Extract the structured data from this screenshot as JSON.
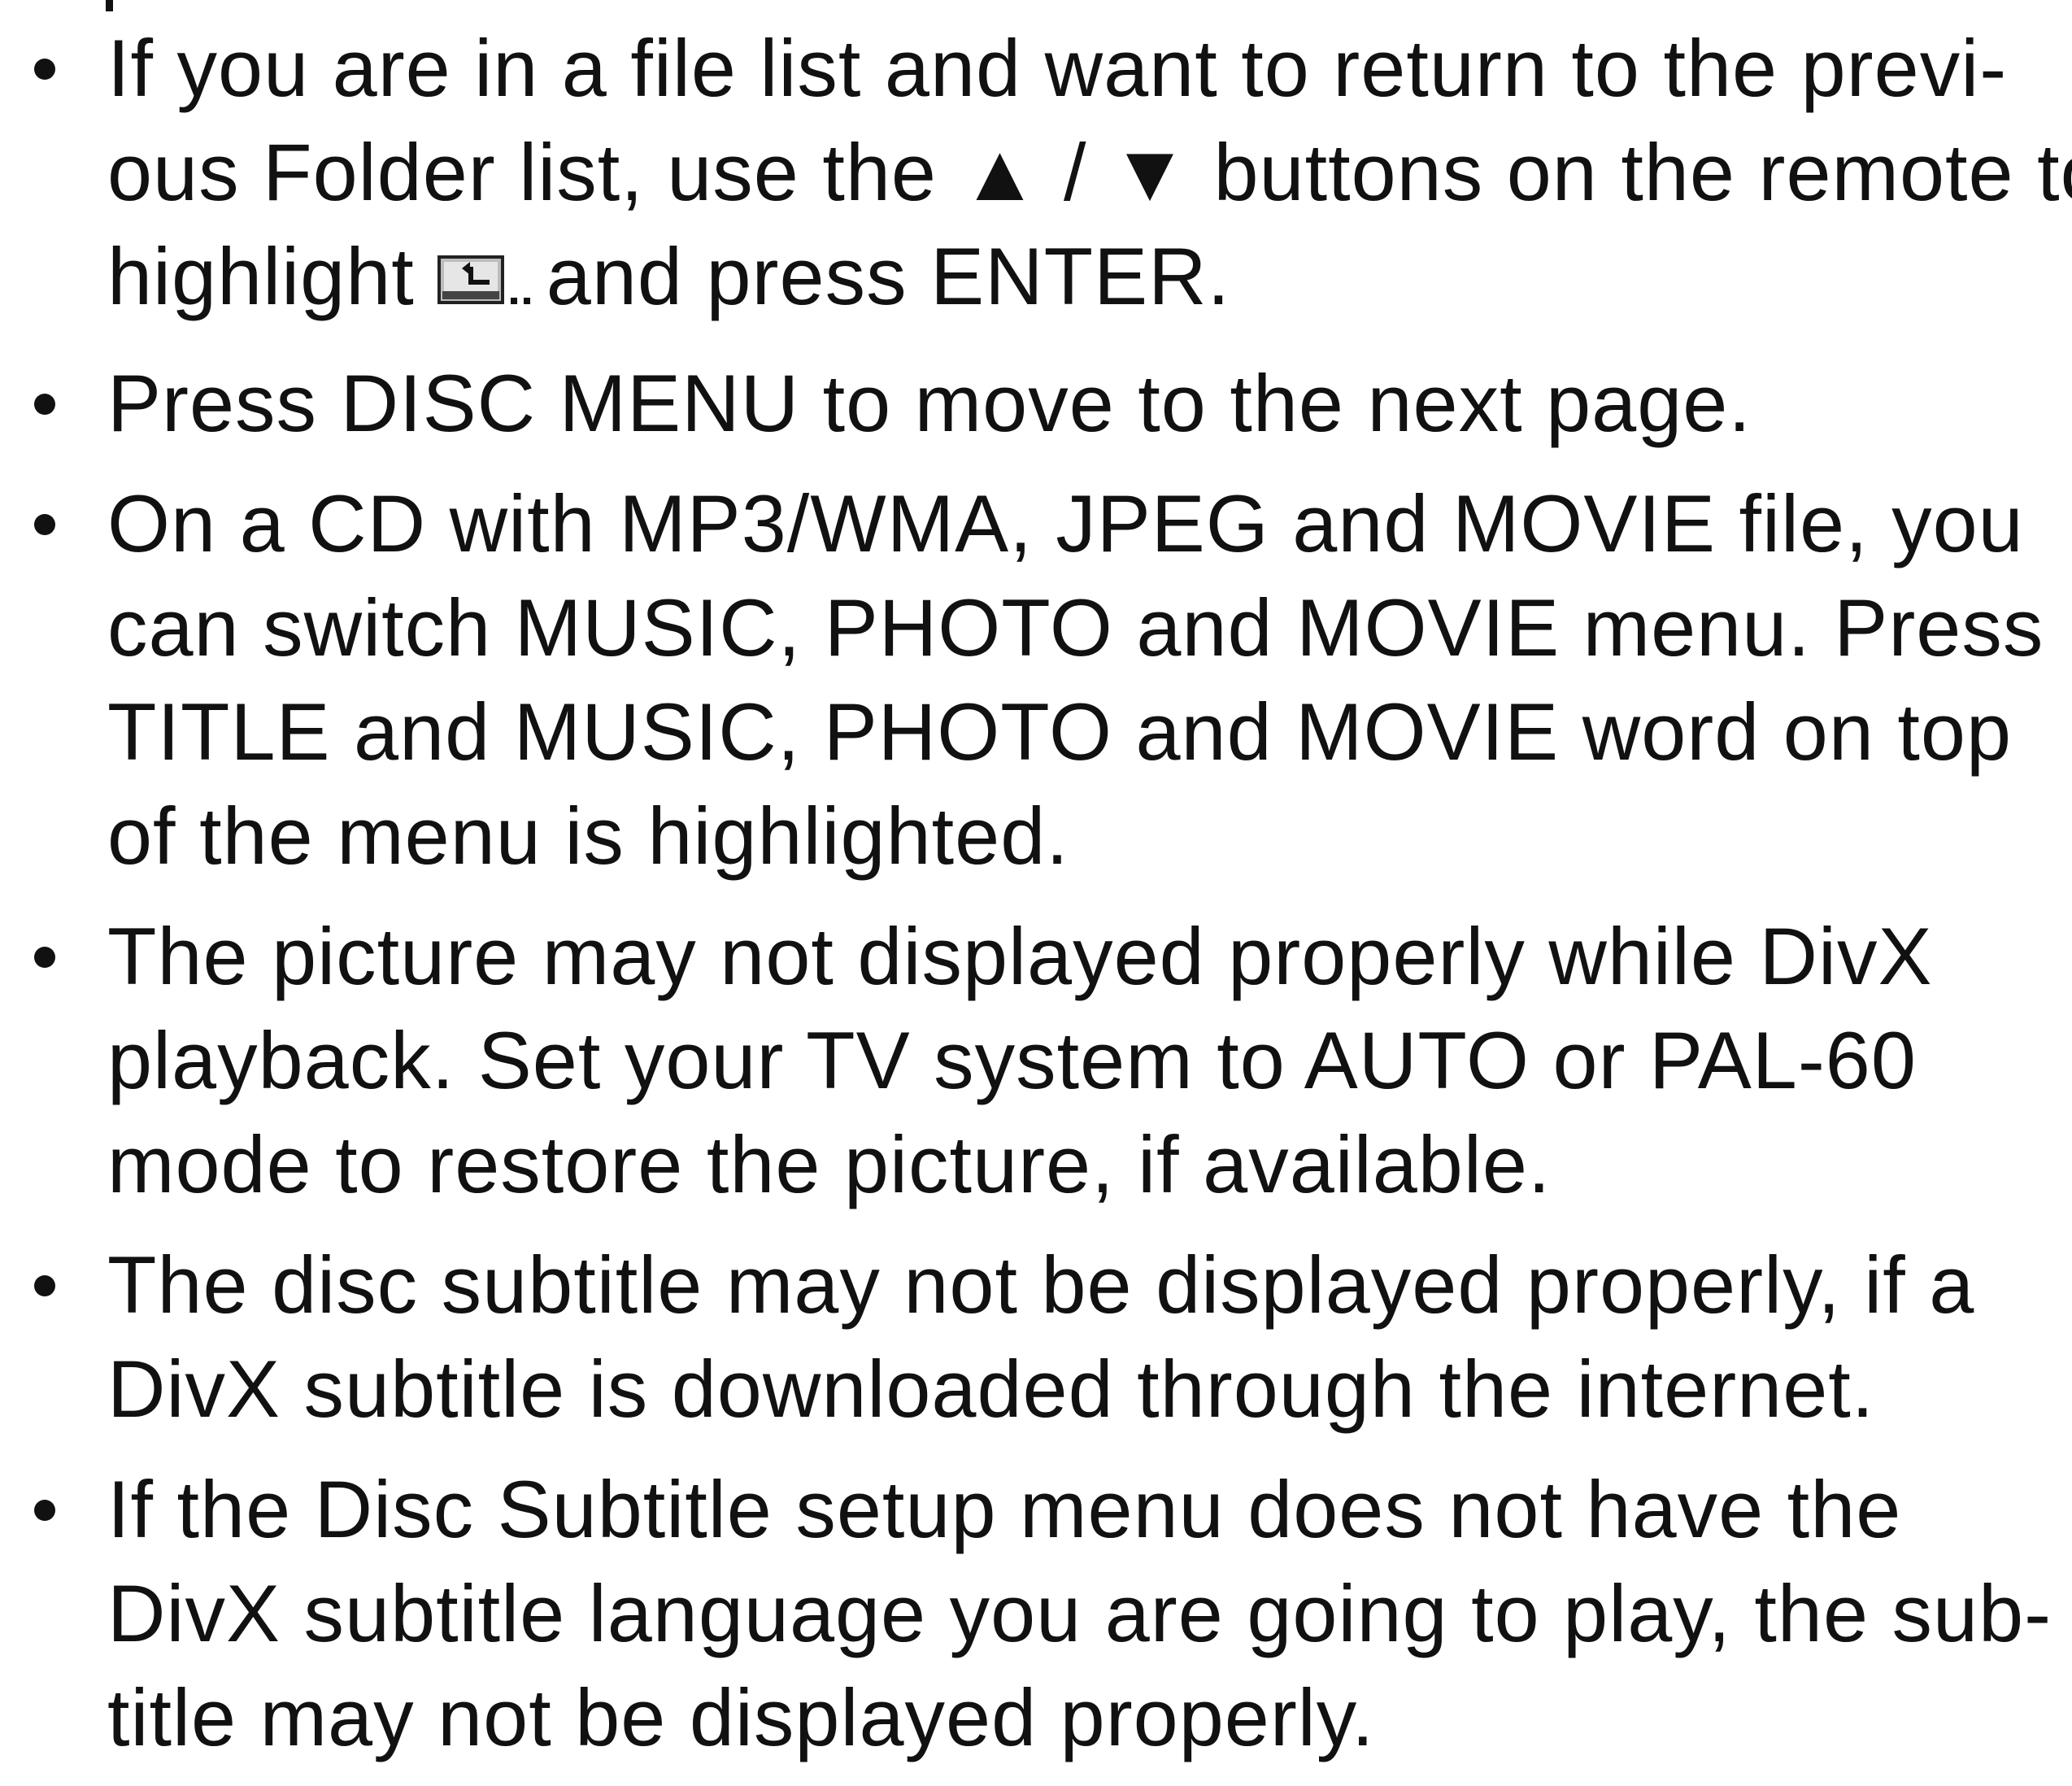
{
  "instructions": {
    "items": [
      {
        "lines": [
          "If you are in a file list and want to return to the previ-",
          "ous Folder list, use the ▲ / ▼ buttons on the remote to"
        ],
        "icon_line": {
          "before": "highlight",
          "icon": "parent-folder-icon",
          "after": "and press ENTER."
        }
      },
      {
        "lines": [
          "Press DISC MENU to move to the next page."
        ]
      },
      {
        "lines": [
          "On a CD with MP3/WMA, JPEG and MOVIE file, you",
          "can switch MUSIC, PHOTO and MOVIE menu. Press",
          "TITLE and MUSIC, PHOTO and MOVIE word on top",
          "of the menu is highlighted."
        ]
      },
      {
        "lines": [
          "The picture may not displayed properly while DivX",
          "playback. Set your TV system to AUTO or PAL-60",
          "mode to restore the picture, if available."
        ]
      },
      {
        "lines": [
          "The disc subtitle may not be displayed properly, if a",
          "DivX subtitle is downloaded through the internet."
        ]
      },
      {
        "lines": [
          "If the Disc Subtitle setup menu does not have the",
          "DivX subtitle language you are going to play, the sub-",
          "title may not be displayed properly."
        ]
      }
    ]
  }
}
